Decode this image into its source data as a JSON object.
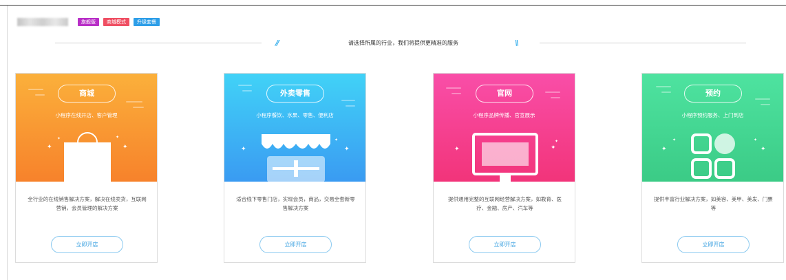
{
  "header": {
    "tags": [
      {
        "label": "旗舰版",
        "color": "#b82fc7"
      },
      {
        "label": "商城模式",
        "color": "#ef4f63"
      },
      {
        "label": "升级套餐",
        "color": "#2d9ee8"
      }
    ]
  },
  "divider": {
    "text": "请选择所属的行业，我们将提供更精准的服务",
    "accent_color": "#3ab0ec"
  },
  "cards": [
    {
      "title": "商城",
      "subtitle": "小程序在线开店、客户管理",
      "description": "全行业的在线销售解决方案，解决在线卖货，互联网营销，会员管理的解决方案",
      "button": "立即开店",
      "gradient": [
        "#fbb03b",
        "#f7822b"
      ],
      "icon": "shopping-bag-icon"
    },
    {
      "title": "外卖零售",
      "subtitle": "小程序餐饮、水果、零售、便利店",
      "description": "适合线下零售门店，实现会员，商品，交易全套新零售解决方案",
      "button": "立即开店",
      "gradient": [
        "#41d2f7",
        "#3a9bf2"
      ],
      "icon": "storefront-icon"
    },
    {
      "title": "官网",
      "subtitle": "小程序品牌传播、官宣展示",
      "description": "提供通用完整的互联网经营解决方案，如教育、医疗、金融、房产、汽车等",
      "button": "立即开店",
      "gradient": [
        "#f94ea8",
        "#f2347a"
      ],
      "icon": "monitor-icon"
    },
    {
      "title": "预约",
      "subtitle": "小程序预约服务、上门到店",
      "description": "提供丰富行业解决方案，如美容、美甲、美发、门票等",
      "button": "立即开店",
      "gradient": [
        "#4ee3a0",
        "#3bcb86"
      ],
      "icon": "apps-grid-icon"
    }
  ]
}
